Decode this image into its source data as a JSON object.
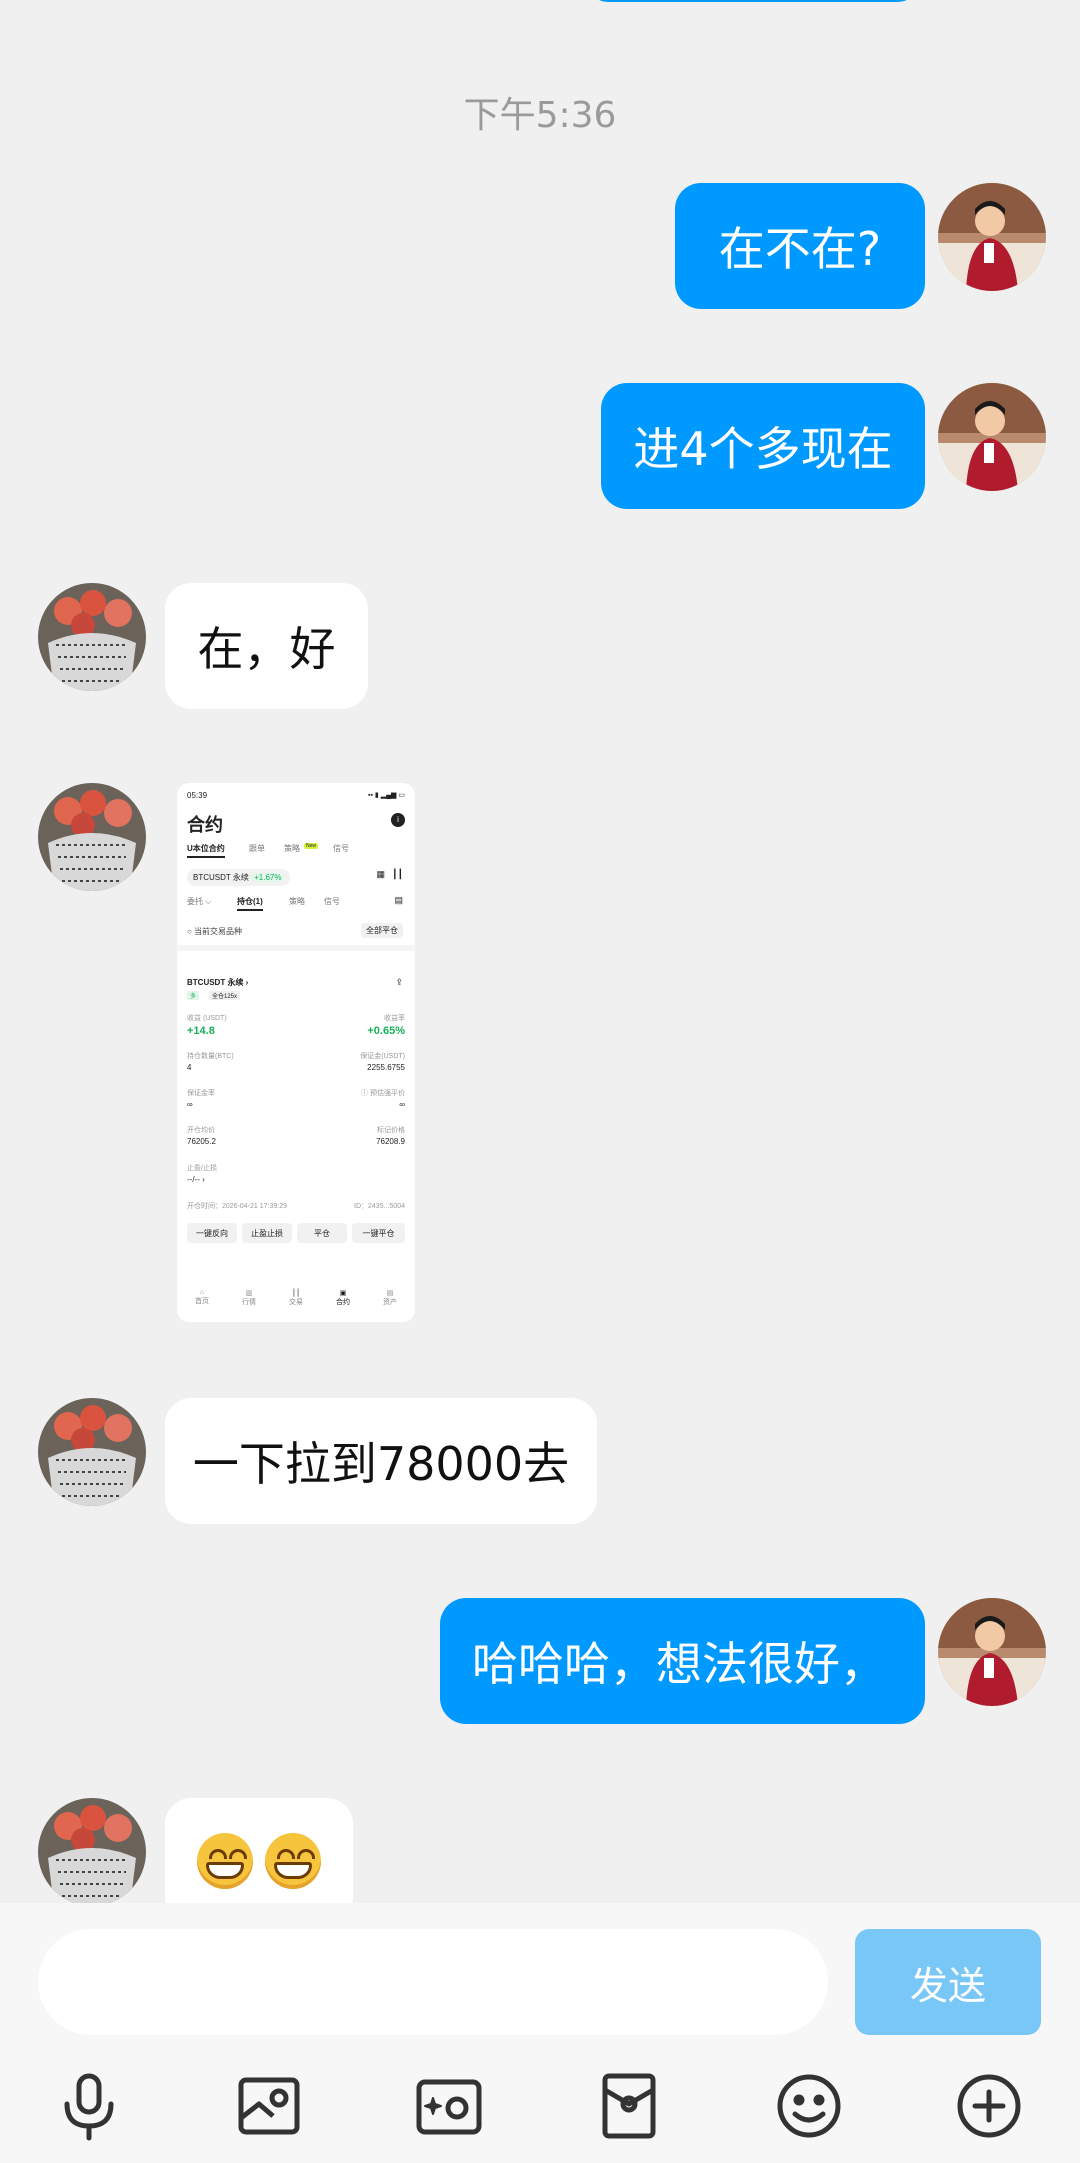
{
  "timestamp": "下午5:36",
  "messages": [
    {
      "from": "me",
      "text": "在不在?"
    },
    {
      "from": "me",
      "text": "进4个多现在"
    },
    {
      "from": "them",
      "text": "在，好"
    },
    {
      "from": "them",
      "type": "image",
      "screenshot": {
        "status_time": "05:39",
        "title": "合约",
        "tabs": [
          "U本位合约",
          "跟单",
          "策略",
          "信号"
        ],
        "new_badge": "New",
        "pair": "BTCUSDT 永续",
        "pair_change": "+1.67%",
        "subtabs": [
          "委托",
          "持仓(1)",
          "策略",
          "信号"
        ],
        "filter_label": "当前交易品种",
        "close_all": "全部平仓",
        "position_name": "BTCUSDT 永续",
        "position_side": "多",
        "position_margin": "全仓125x",
        "pnl_label": "收益 (USDT)",
        "pnl_value": "+14.8",
        "roe_label": "收益率",
        "roe_value": "+0.65%",
        "qty_label": "持仓数量(BTC)",
        "qty_value": "4",
        "margin_label": "保证金(USDT)",
        "margin_value": "2255.6755",
        "ratio_label": "保证金率",
        "ratio_value": "∞",
        "liq_label": "预估强平价",
        "liq_value": "∞",
        "entry_label": "开仓均价",
        "entry_value": "76205.2",
        "mark_label": "标记价格",
        "mark_value": "76208.9",
        "tpsl_label": "止盈/止损",
        "tpsl_value": "--/--",
        "open_time": "开仓时间：2026-04-21 17:39:29",
        "order_id": "ID：2435...5004",
        "buttons": [
          "一键反向",
          "止盈止损",
          "平仓",
          "一键平仓"
        ],
        "nav": [
          "首页",
          "行情",
          "交易",
          "合约",
          "资产"
        ]
      }
    },
    {
      "from": "them",
      "text": "一下拉到78000去"
    },
    {
      "from": "me",
      "text": "哈哈哈，想法很好，"
    },
    {
      "from": "them",
      "type": "emoji",
      "emoji": "grinning-face"
    }
  ],
  "input": {
    "placeholder": "",
    "send_label": "发送"
  },
  "toolbar": [
    "microphone-icon",
    "image-icon",
    "camera-icon",
    "red-packet-icon",
    "emoji-icon",
    "plus-icon"
  ],
  "colors": {
    "my_bubble": "#0099ff",
    "their_bubble": "#ffffff",
    "background": "#f0f0f0",
    "send_button": "#79c7f7"
  }
}
